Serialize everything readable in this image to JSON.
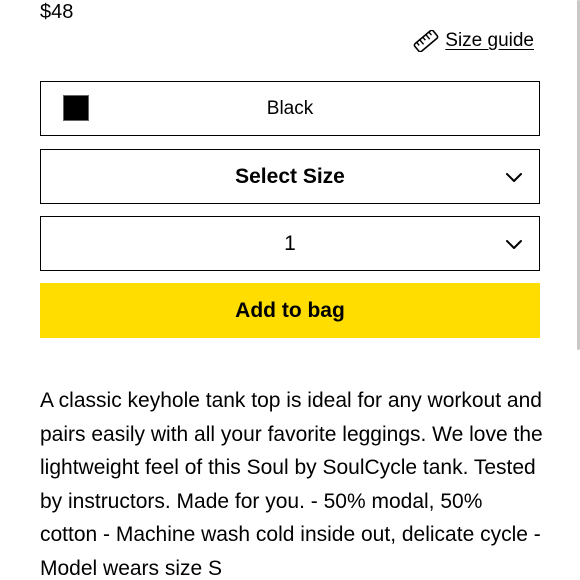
{
  "product": {
    "price": "$48"
  },
  "size_guide": {
    "label": "Size guide",
    "icon": "ruler-icon"
  },
  "color_selector": {
    "selected_color_name": "Black",
    "swatch_color": "#000000"
  },
  "size_selector": {
    "selected": "Select Size",
    "icon": "chevron-down-icon"
  },
  "quantity_selector": {
    "selected": "1",
    "icon": "chevron-down-icon"
  },
  "add_to_bag": {
    "label": "Add to bag",
    "background_color": "#ffdd00"
  },
  "description": {
    "text": "A classic keyhole tank top is ideal for any workout and pairs easily with all your favorite leggings. We love the lightweight feel of this Soul by SoulCycle tank. Tested by instructors. Made for you. - 50% modal, 50% cotton - Machine wash cold inside out, delicate cycle - Model wears size S"
  }
}
